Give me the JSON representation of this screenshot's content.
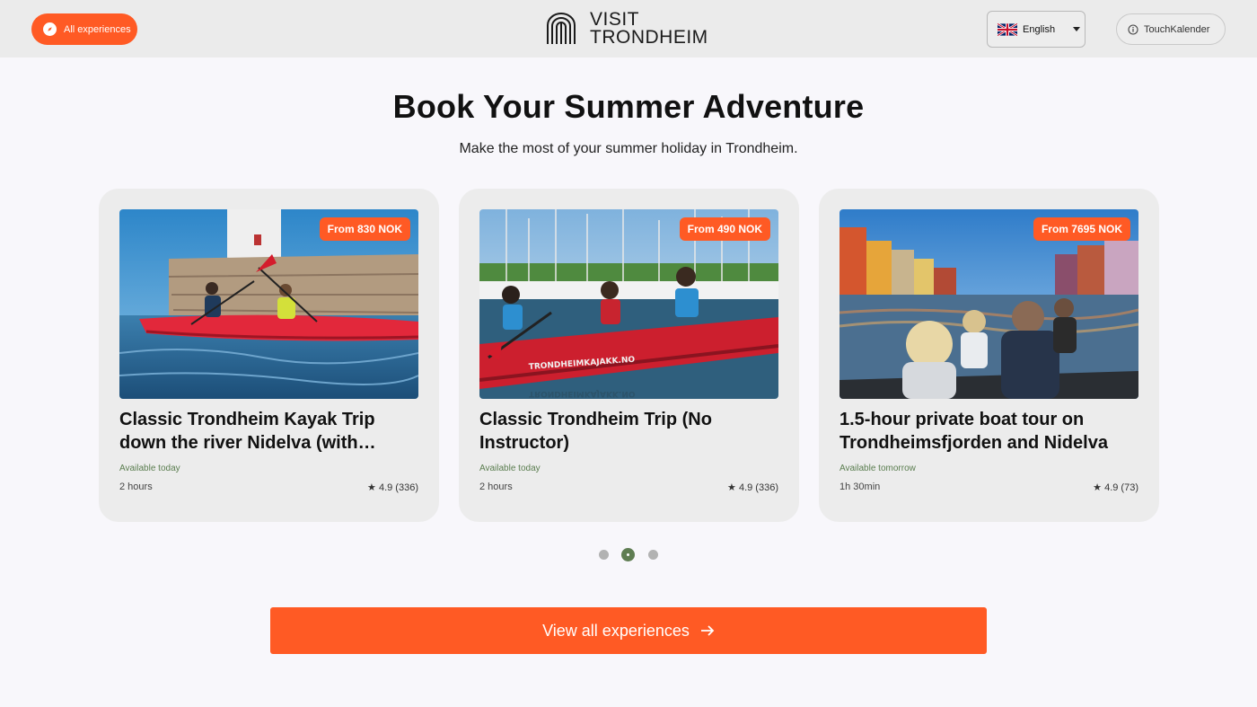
{
  "header": {
    "all_experiences_label": "All experiences",
    "logo_line1": "VISIT",
    "logo_line2": "TRONDHEIM",
    "language": "English",
    "touch_label": "TouchKalender"
  },
  "hero": {
    "title": "Book Your Summer Adventure",
    "subtitle": "Make the most of your summer holiday in Trondheim."
  },
  "cards": [
    {
      "price": "From 830 NOK",
      "name": "Classic Trondheim Kayak Trip down the river Nidelva (with instructor)",
      "availability": "Available today",
      "duration": "2 hours",
      "rating": "★ 4.9 (336)",
      "image": "kayak-lighthouse-photo"
    },
    {
      "price": "From 490 NOK",
      "name": "Classic Trondheim Trip (No Instructor)",
      "availability": "Available today",
      "duration": "2 hours",
      "rating": "★ 4.9 (336)",
      "image": "kayak-marina-photo",
      "image_text": "TRONDHEIMKAJAKK.NO"
    },
    {
      "price": "From 7695 NOK",
      "name": "1.5-hour private boat tour on Trondheimsfjorden and Nidelva",
      "availability": "Available tomorrow",
      "duration": "1h 30min",
      "rating": "★ 4.9 (73)",
      "image": "boat-tour-photo"
    }
  ],
  "pagination": {
    "count": 3,
    "active": 2
  },
  "cta": {
    "label": "View all experiences"
  },
  "colors": {
    "accent": "#ff5a24",
    "green": "#5f7d52",
    "availability": "#5a7d4f"
  }
}
